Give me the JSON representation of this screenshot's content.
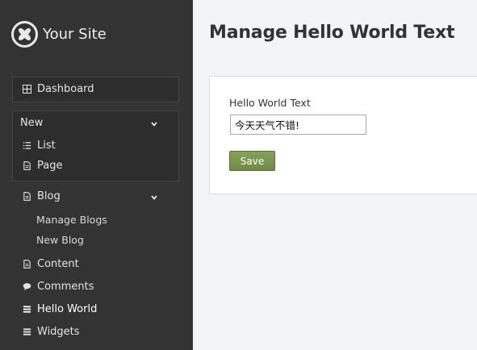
{
  "site": {
    "name": "Your Site"
  },
  "page": {
    "title": "Manage Hello World Text"
  },
  "nav": {
    "dashboard": "Dashboard",
    "new_group": {
      "label": "New",
      "items": [
        "List",
        "Page"
      ]
    },
    "blog_group": {
      "label": "Blog",
      "items": [
        "Manage Blogs",
        "New Blog"
      ]
    },
    "content": "Content",
    "comments": "Comments",
    "hello_world": "Hello World",
    "widgets": "Widgets"
  },
  "form": {
    "label": "Hello World Text",
    "value": "今天天气不错!",
    "save_label": "Save"
  },
  "colors": {
    "sidebar": "#333333",
    "accent_button": "#7a974e",
    "background": "#f3f4f6"
  }
}
